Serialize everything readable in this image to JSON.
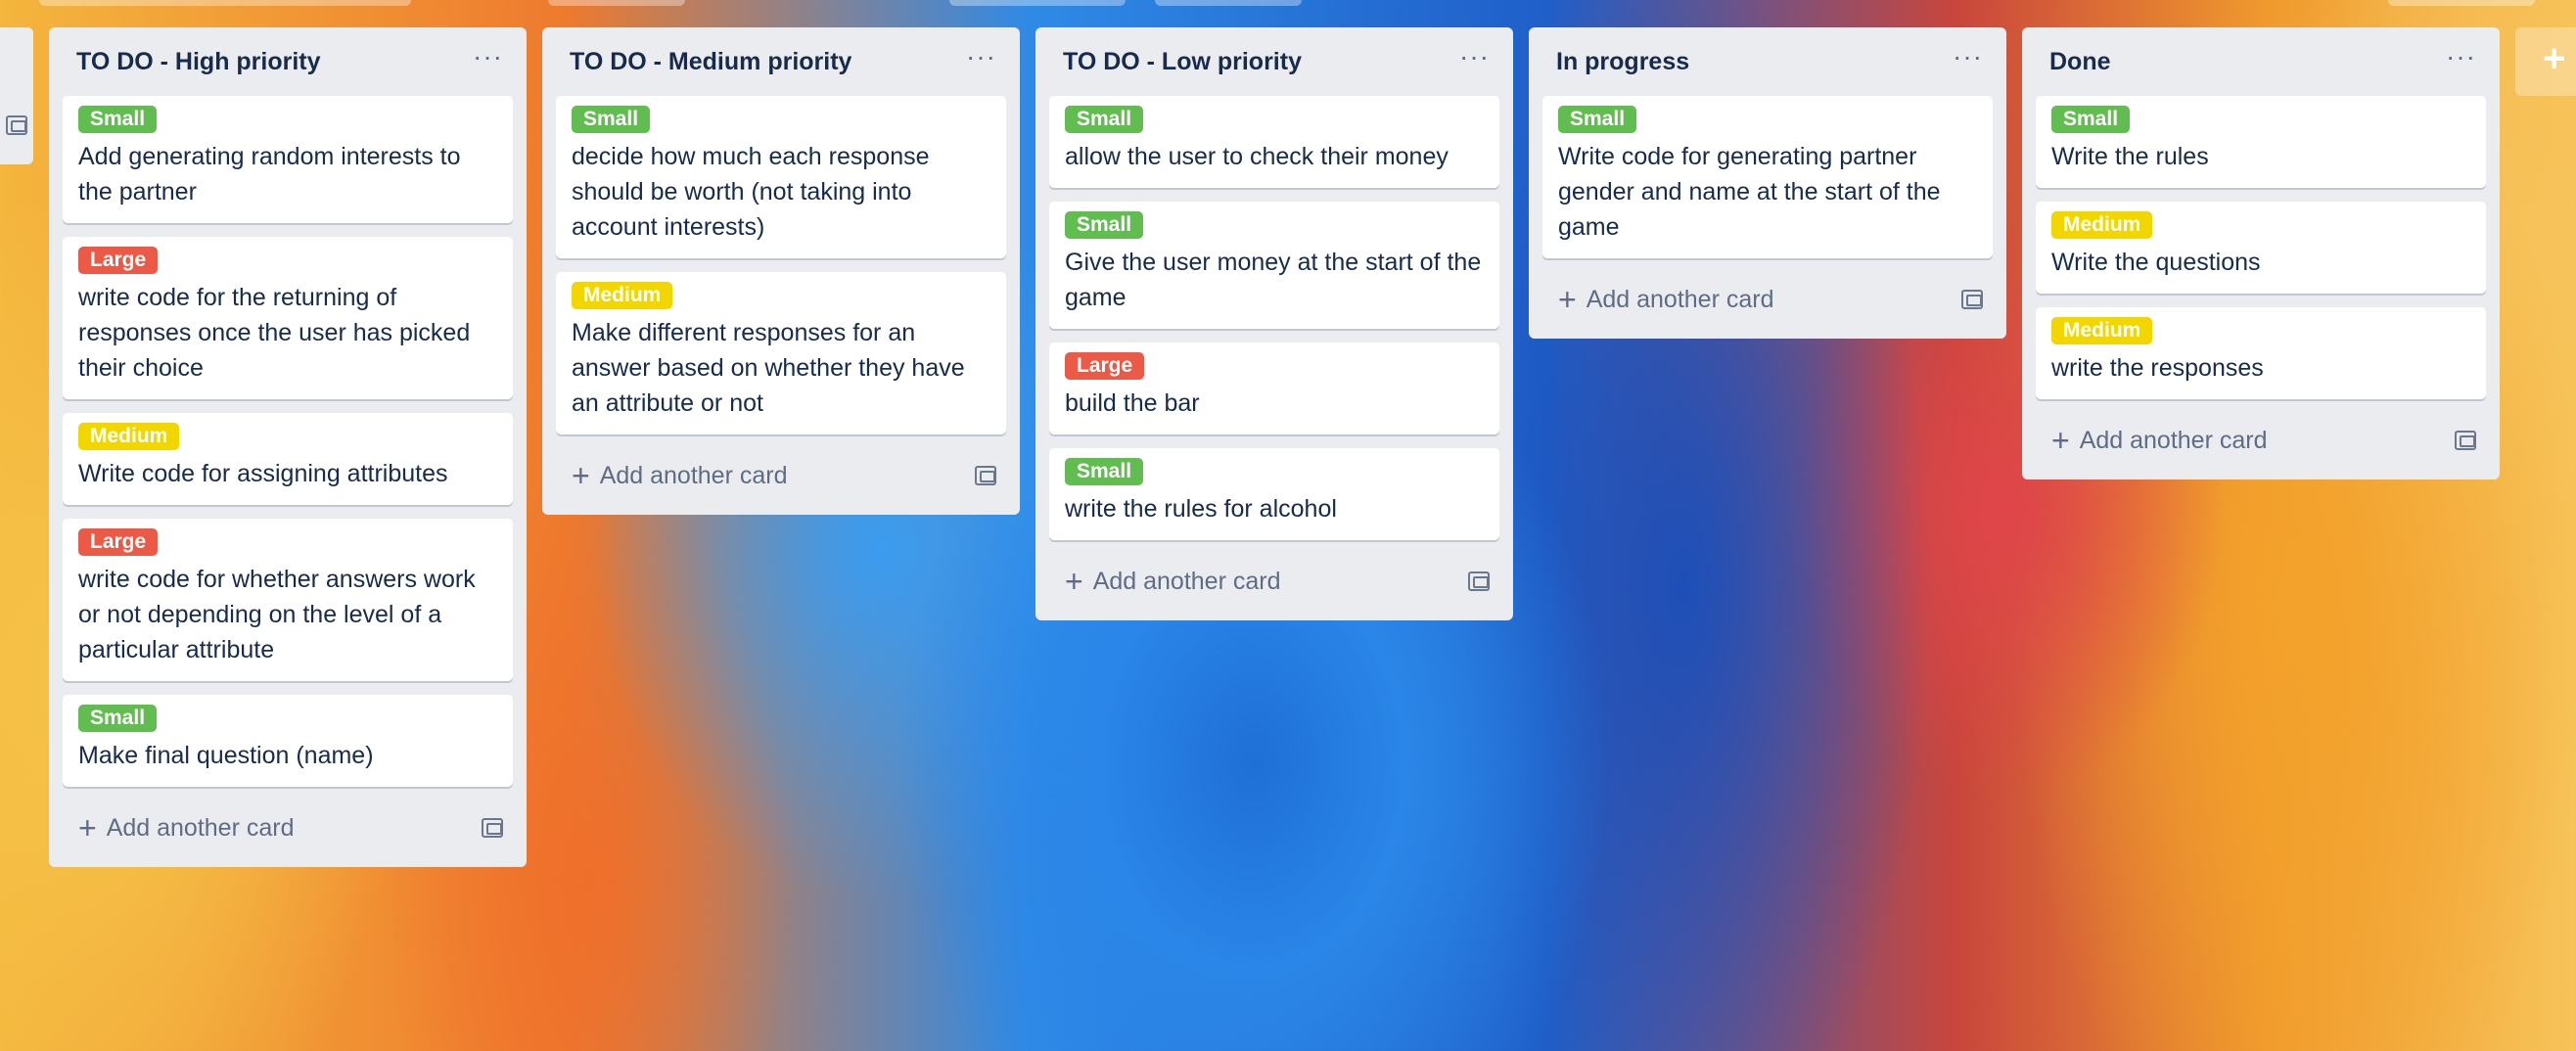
{
  "colors": {
    "label_small": "#61bd4f",
    "label_medium": "#f2d600",
    "label_large": "#eb5a46",
    "list_bg": "#ebecf0"
  },
  "lists": [
    {
      "title": "TO DO - High priority",
      "menu": "···",
      "add_label": "Add another card",
      "cards": [
        {
          "label": "Small",
          "text": "Add generating random interests to the partner"
        },
        {
          "label": "Large",
          "text": "write code for the returning of responses once the user has picked their choice"
        },
        {
          "label": "Medium",
          "text": "Write code for assigning attributes"
        },
        {
          "label": "Large",
          "text": "write code for whether answers work or not depending on the level of a particular attribute"
        },
        {
          "label": "Small",
          "text": "Make final question (name)"
        }
      ]
    },
    {
      "title": "TO DO - Medium priority",
      "menu": "···",
      "add_label": "Add another card",
      "cards": [
        {
          "label": "Small",
          "text": "decide how much each response should be worth (not taking into account interests)"
        },
        {
          "label": "Medium",
          "text": "Make different responses for an answer based on whether they have an attribute or not"
        }
      ]
    },
    {
      "title": "TO DO - Low priority",
      "menu": "···",
      "add_label": "Add another card",
      "cards": [
        {
          "label": "Small",
          "text": "allow the user to check their money"
        },
        {
          "label": "Small",
          "text": "Give the user money at the start of the game"
        },
        {
          "label": "Large",
          "text": "build the bar"
        },
        {
          "label": "Small",
          "text": "write the rules for alcohol"
        }
      ]
    },
    {
      "title": "In progress",
      "menu": "···",
      "add_label": "Add another card",
      "cards": [
        {
          "label": "Small",
          "text": "Write code for generating partner gender and name at the start of the game"
        }
      ]
    },
    {
      "title": "Done",
      "menu": "···",
      "add_label": "Add another card",
      "cards": [
        {
          "label": "Small",
          "text": "Write the rules"
        },
        {
          "label": "Medium",
          "text": "Write the questions"
        },
        {
          "label": "Medium",
          "text": "write the responses"
        }
      ]
    }
  ],
  "add_list_symbol": "+"
}
